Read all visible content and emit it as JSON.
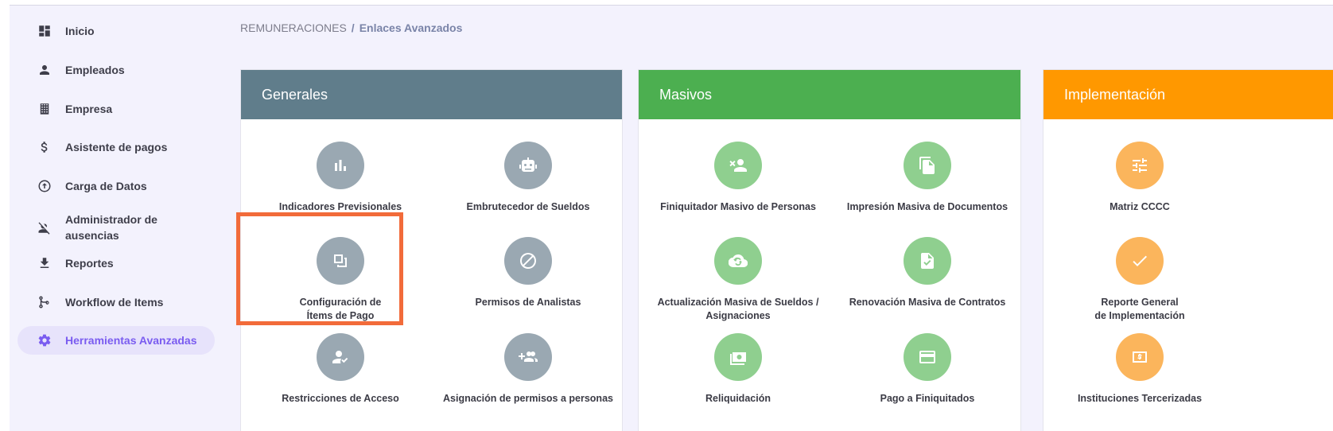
{
  "sidebar": {
    "items": [
      {
        "label": "Inicio",
        "icon": "dashboard-icon"
      },
      {
        "label": "Empleados",
        "icon": "person-icon"
      },
      {
        "label": "Empresa",
        "icon": "building-icon"
      },
      {
        "label": "Asistente de pagos",
        "icon": "dollar-icon"
      },
      {
        "label": "Carga de Datos",
        "icon": "upload-circle-icon"
      },
      {
        "label": "Administrador de ausencias",
        "icon": "person-off-icon"
      },
      {
        "label": "Reportes",
        "icon": "download-icon"
      },
      {
        "label": "Workflow de Items",
        "icon": "branch-icon"
      },
      {
        "label": "Herramientas Avanzadas",
        "icon": "gear-icon",
        "active": true
      }
    ]
  },
  "breadcrumb": {
    "root": "REMUNERACIONES",
    "separator": "/",
    "current": "Enlaces Avanzados"
  },
  "colors": {
    "generales": "#607d8b",
    "masivos": "#4caf50",
    "implementacion": "#ff9800",
    "active_accent": "#7a5cf0",
    "highlight": "#f26b3a"
  },
  "cards": {
    "generales": {
      "title": "Generales",
      "tools": [
        {
          "label": "Indicadores Previsionales",
          "icon": "bar-chart-icon"
        },
        {
          "label": "Embrutecedor de Sueldos",
          "icon": "robot-icon"
        },
        {
          "label": "Configuración de\nÍtems de Pago",
          "icon": "copy-icon",
          "highlighted": true
        },
        {
          "label": "Permisos de Analistas",
          "icon": "block-icon"
        },
        {
          "label": "Restricciones de Acceso",
          "icon": "person-check-icon"
        },
        {
          "label": "Asignación de permisos a personas",
          "icon": "group-add-icon"
        }
      ]
    },
    "masivos": {
      "title": "Masivos",
      "tools": [
        {
          "label": "Finiquitador Masivo de Personas",
          "icon": "person-remove-icon"
        },
        {
          "label": "Impresión Masiva de Documentos",
          "icon": "documents-icon"
        },
        {
          "label": "Actualización Masiva de Sueldos / Asignaciones",
          "icon": "cloud-sync-icon"
        },
        {
          "label": "Renovación Masiva de Contratos",
          "icon": "file-check-icon"
        },
        {
          "label": "Reliquidación",
          "icon": "money-icon"
        },
        {
          "label": "Pago a Finiquitados",
          "icon": "card-icon"
        }
      ]
    },
    "implementacion": {
      "title": "Implementación",
      "tools": [
        {
          "label": "Matriz CCCC",
          "icon": "tune-icon"
        },
        {
          "label": "Reporte General\nde Implementación",
          "icon": "check-icon"
        },
        {
          "label": "Instituciones Tercerizadas",
          "icon": "cash-icon"
        }
      ]
    }
  }
}
